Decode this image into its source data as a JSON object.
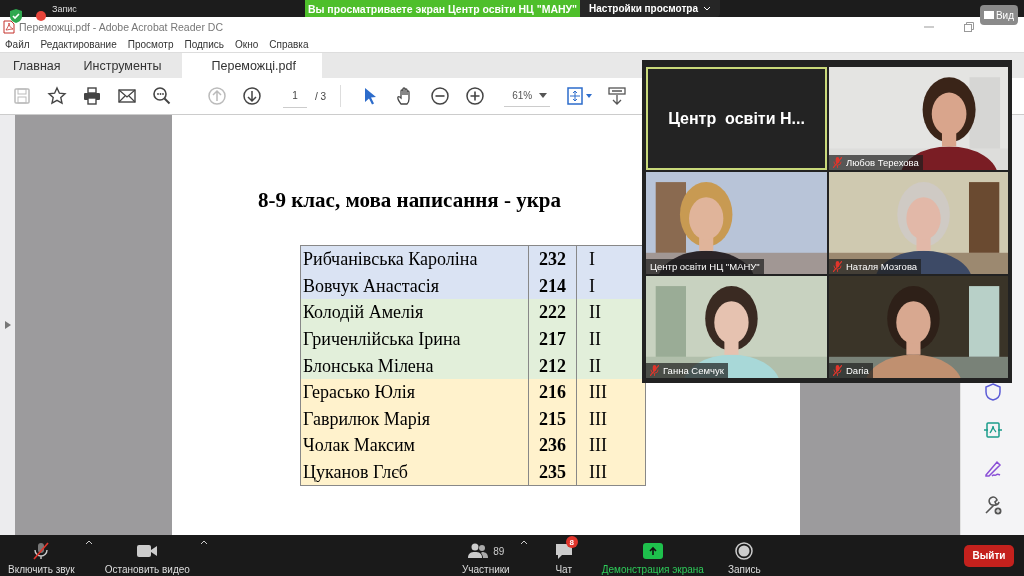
{
  "zoom_top": {
    "recording_label": "Запис",
    "banner": "Вы просматриваете экран Центр освіти НЦ \"МАНУ\"",
    "view_options": "Настройки просмотра",
    "view_button": "Вид"
  },
  "window": {
    "title": "Переможці.pdf - Adobe Acrobat Reader DC"
  },
  "menu": [
    "Файл",
    "Редактирование",
    "Просмотр",
    "Подпись",
    "Окно",
    "Справка"
  ],
  "tabs": [
    {
      "label": "Главная",
      "selected": false,
      "kind": "nav"
    },
    {
      "label": "Инструменты",
      "selected": false,
      "kind": "nav"
    },
    {
      "label": "Переможці.pdf",
      "selected": true,
      "kind": "document"
    }
  ],
  "toolbar": {
    "left": [
      {
        "kind": "save",
        "disabled": true
      },
      {
        "kind": "star",
        "disabled": false
      },
      {
        "kind": "print",
        "disabled": false
      },
      {
        "kind": "mail",
        "disabled": false
      },
      {
        "kind": "find",
        "disabled": false
      },
      {
        "kind": "prev",
        "disabled": true
      },
      {
        "kind": "next",
        "disabled": false
      }
    ],
    "page": "1",
    "page_total": "/ 3",
    "right": [
      {
        "kind": "select"
      },
      {
        "kind": "hand"
      },
      {
        "kind": "zoom-out"
      },
      {
        "kind": "zoom-in"
      }
    ],
    "zoom": "61%"
  },
  "document": {
    "heading": "8-9 клас, мова написання - укра",
    "rows": [
      {
        "name": "Рибчанівська Кароліна",
        "score": "232",
        "place": "I",
        "color": "#dae3f3"
      },
      {
        "name": "Вовчук Анастасія",
        "score": "214",
        "place": "I",
        "color": "#dae3f3"
      },
      {
        "name": "Колодій Амелія",
        "score": "222",
        "place": "II",
        "color": "#e2efda"
      },
      {
        "name": "Гриченлійська Ірина",
        "score": "217",
        "place": "II",
        "color": "#e2efda"
      },
      {
        "name": "Блонська Мілена",
        "score": "212",
        "place": "II",
        "color": "#e2efda"
      },
      {
        "name": "Герасько Юлія",
        "score": "216",
        "place": "III",
        "color": "#fff2cc"
      },
      {
        "name": "Гаврилюк Марія",
        "score": "215",
        "place": "III",
        "color": "#fff2cc"
      },
      {
        "name": "Чолак Максим",
        "score": "236",
        "place": "III",
        "color": "#fff2cc"
      },
      {
        "name": "Цуканов Глєб",
        "score": "235",
        "place": "III",
        "color": "#fff2cc"
      }
    ]
  },
  "side_tools": [
    {
      "kind": "protect"
    },
    {
      "kind": "export"
    },
    {
      "kind": "sign"
    },
    {
      "kind": "more-tools"
    }
  ],
  "participants": [
    {
      "name": "Центр  освіти Н...",
      "kind": "name",
      "active": true
    },
    {
      "name": "Любов Терехова",
      "kind": "video",
      "active": false,
      "muted": true
    },
    {
      "name": "Центр освіти НЦ \"МАНУ\"",
      "kind": "video",
      "active": false,
      "muted": false
    },
    {
      "name": "Наталя Мозгова",
      "kind": "video",
      "active": false,
      "muted": true
    },
    {
      "name": "Ганна Семчук",
      "kind": "video",
      "active": false,
      "muted": true
    },
    {
      "name": "Daria",
      "kind": "video",
      "active": false,
      "muted": true
    }
  ],
  "meeting_controls": [
    {
      "kind": "audio",
      "label": "Включить звук",
      "muted": true
    },
    {
      "kind": "video",
      "label": "Остановить видео"
    },
    {
      "kind": "participants",
      "label": "Участники",
      "count": "89"
    },
    {
      "kind": "chat",
      "label": "Чат",
      "badge": "8"
    },
    {
      "kind": "share",
      "label": "Демонстрация экрана"
    },
    {
      "kind": "record",
      "label": "Запись"
    }
  ],
  "leave": "Выйти"
}
